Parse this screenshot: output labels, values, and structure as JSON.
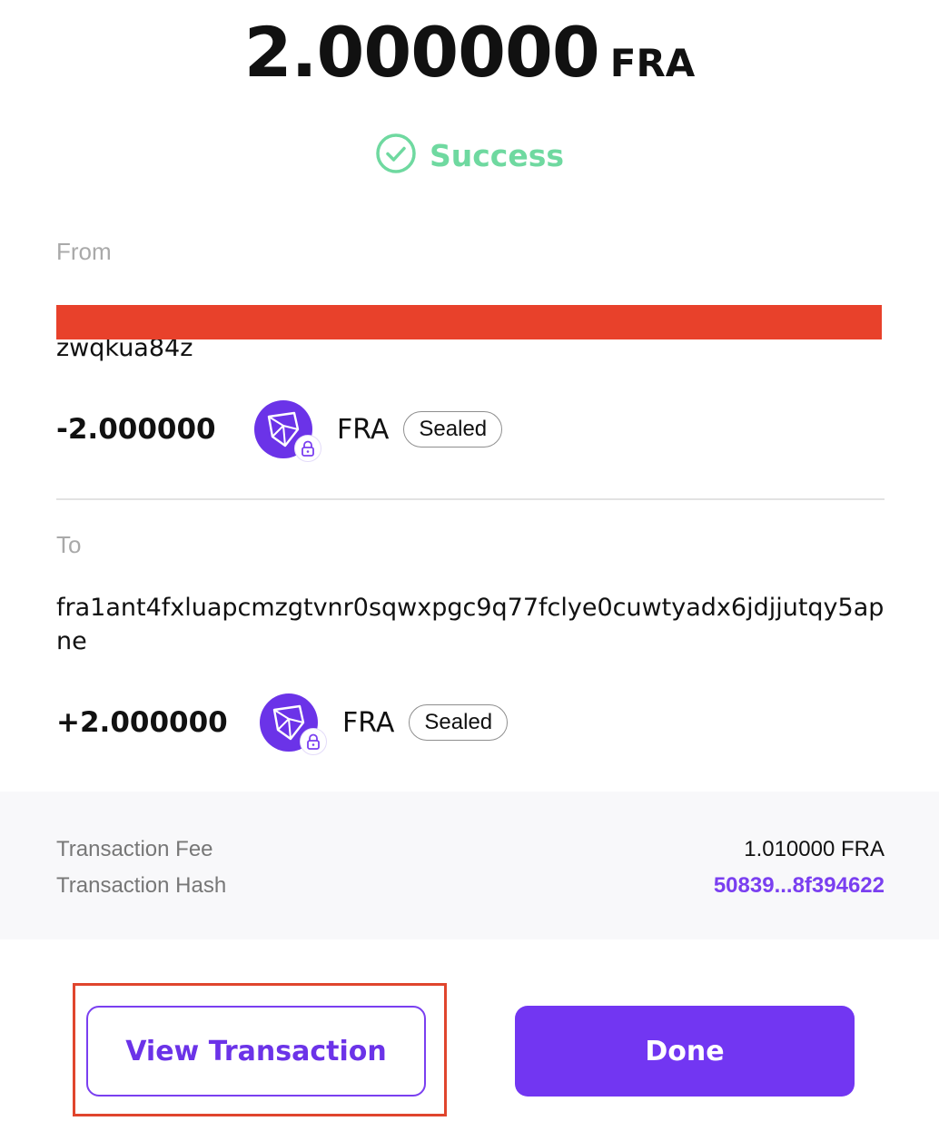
{
  "header": {
    "amount": "2.000000",
    "unit": "FRA",
    "status": "Success",
    "status_color": "#6fd9a0"
  },
  "from": {
    "label": "From",
    "address_tail": "zwqkua84z",
    "amount": "-2.000000",
    "token_icon": "findora-logo-icon",
    "token_symbol": "FRA",
    "badge": "Sealed"
  },
  "to": {
    "label": "To",
    "address": "fra1ant4fxluapcmzgtvnr0sqwxpgc9q77fclye0cuwtyadx6jdjjutqy5apne",
    "amount": "+2.000000",
    "token_icon": "findora-logo-icon",
    "token_symbol": "FRA",
    "badge": "Sealed"
  },
  "details": {
    "fee_label": "Transaction Fee",
    "fee_value": "1.010000 FRA",
    "hash_label": "Transaction Hash",
    "hash_value": "50839...8f394622"
  },
  "actions": {
    "view_label": "View Transaction",
    "done_label": "Done"
  },
  "colors": {
    "accent": "#7236f2",
    "redaction": "#e8412b",
    "highlight": "#e0452d"
  }
}
